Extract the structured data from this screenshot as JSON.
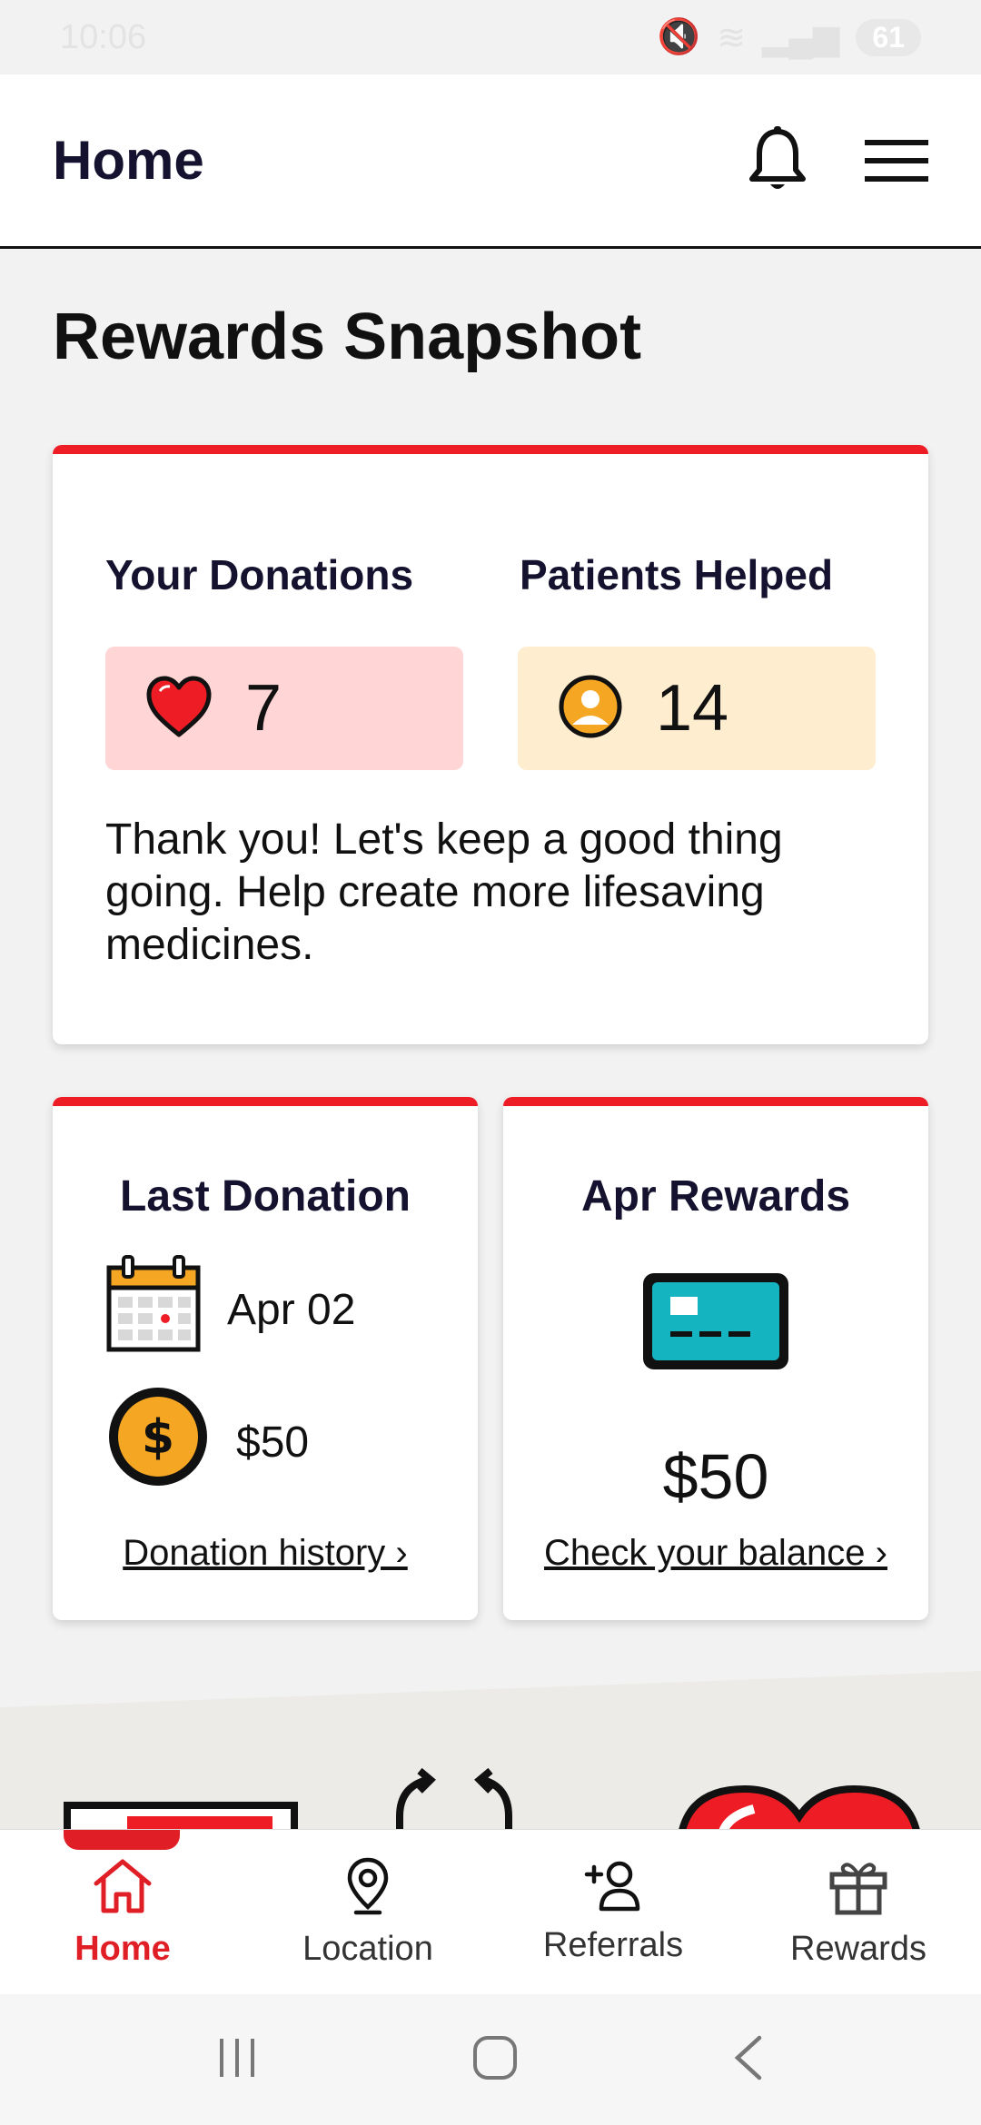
{
  "status_bar": {
    "time": "10:06",
    "battery": "61"
  },
  "header": {
    "title": "Home"
  },
  "page_title": "Rewards Snapshot",
  "snapshot": {
    "donations_label": "Your Donations",
    "donations_value": "7",
    "patients_label": "Patients Helped",
    "patients_value": "14",
    "message": "Thank you! Let's keep a good thing going. Help create more lifesaving medicines."
  },
  "last_donation": {
    "title": "Last Donation",
    "date": "Apr 02",
    "amount": "$50",
    "link": "Donation history ›"
  },
  "rewards_card": {
    "title": "Apr Rewards",
    "amount": "$50",
    "link": "Check your balance ›"
  },
  "bottom_nav": {
    "items": [
      {
        "label": "Home",
        "icon": "home-icon"
      },
      {
        "label": "Location",
        "icon": "location-pin-icon"
      },
      {
        "label": "Referrals",
        "icon": "add-person-icon"
      },
      {
        "label": "Rewards",
        "icon": "gift-icon"
      }
    ],
    "active": "Home"
  },
  "colors": {
    "accent_red": "#ee1c25",
    "navy": "#14122e",
    "donations_bg": "#ffd5d5",
    "patients_bg": "#ffedcf",
    "teal": "#14b4c0",
    "gold": "#f5a623"
  }
}
